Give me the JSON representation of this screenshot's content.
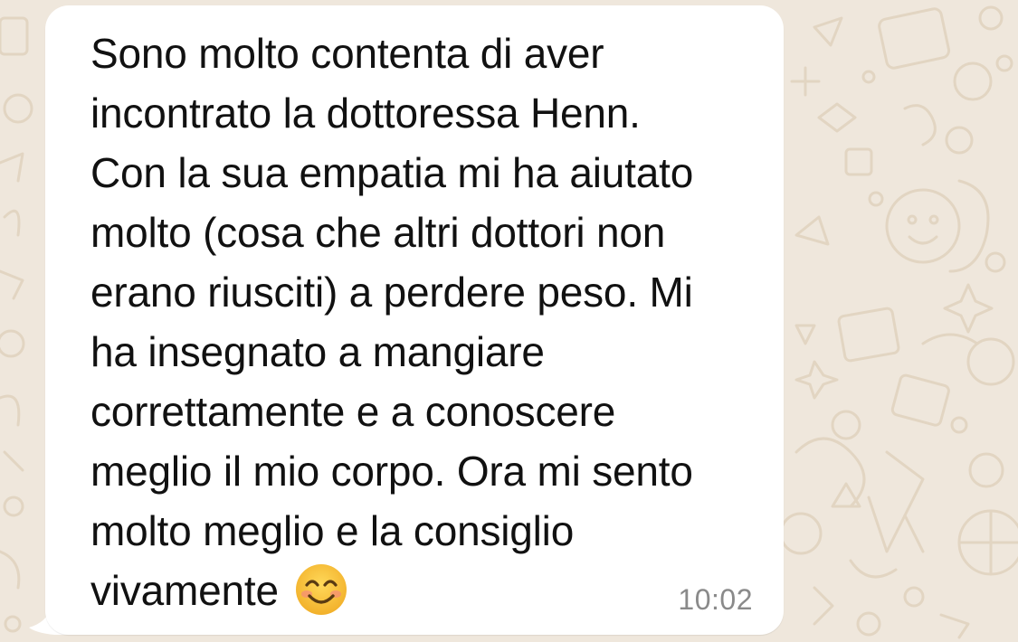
{
  "message": {
    "lines": [
      "Sono molto contenta di aver",
      "incontrato la dottoressa Henn.",
      "Con la sua empatia mi ha aiutato",
      "molto (cosa che altri dottori non",
      "erano riusciti) a perdere peso. Mi",
      "ha insegnato a mangiare",
      "correttamente e a conoscere",
      "meglio il mio corpo. Ora mi sento",
      "molto meglio e la consiglio",
      "vivamente"
    ],
    "emoji": "smiling-face-with-smiling-eyes",
    "time": "10:02"
  },
  "colors": {
    "wallpaper": "#efe7dc",
    "wallpaper_doodle": "#e3d6c4",
    "bubble": "#ffffff",
    "text": "#111111",
    "timestamp": "#8a8a8a",
    "emoji_face": "#f7c637"
  }
}
